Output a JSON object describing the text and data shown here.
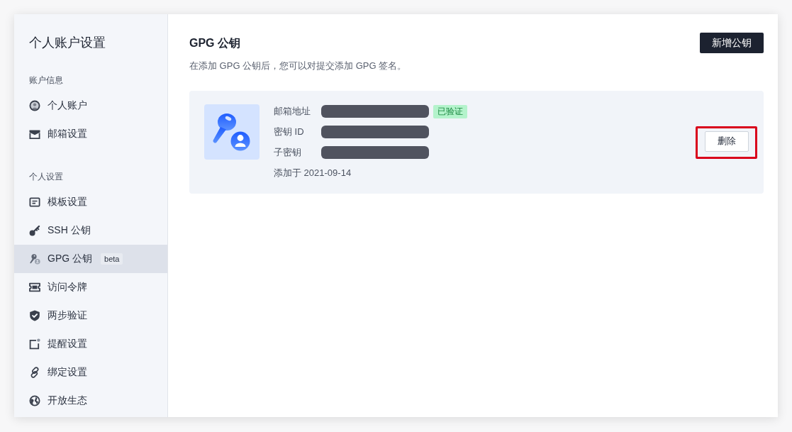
{
  "sidebar": {
    "title": "个人账户设置",
    "sections": [
      {
        "heading": "账户信息",
        "items": [
          {
            "label": "个人账户",
            "selected": false
          },
          {
            "label": "邮箱设置",
            "selected": false
          }
        ]
      },
      {
        "heading": "个人设置",
        "items": [
          {
            "label": "模板设置",
            "selected": false
          },
          {
            "label": "SSH 公钥",
            "selected": false
          },
          {
            "label": "GPG 公钥",
            "badge": "beta",
            "selected": true
          },
          {
            "label": "访问令牌",
            "selected": false
          },
          {
            "label": "两步验证",
            "selected": false
          },
          {
            "label": "提醒设置",
            "selected": false
          },
          {
            "label": "绑定设置",
            "selected": false
          },
          {
            "label": "开放生态",
            "selected": false
          }
        ]
      }
    ]
  },
  "header": {
    "title": "GPG 公钥",
    "description": "在添加 GPG 公钥后，您可以对提交添加 GPG 签名。",
    "add_button": "新增公钥"
  },
  "keys": [
    {
      "fields": [
        {
          "label": "邮箱地址",
          "redacted": true,
          "badge": "已验证"
        },
        {
          "label": "密钥 ID",
          "redacted": true
        },
        {
          "label": "子密钥",
          "redacted": true
        }
      ],
      "added": "添加于 2021-09-14",
      "delete_button": {
        "label": "删除",
        "highlighted": true
      }
    }
  ]
}
